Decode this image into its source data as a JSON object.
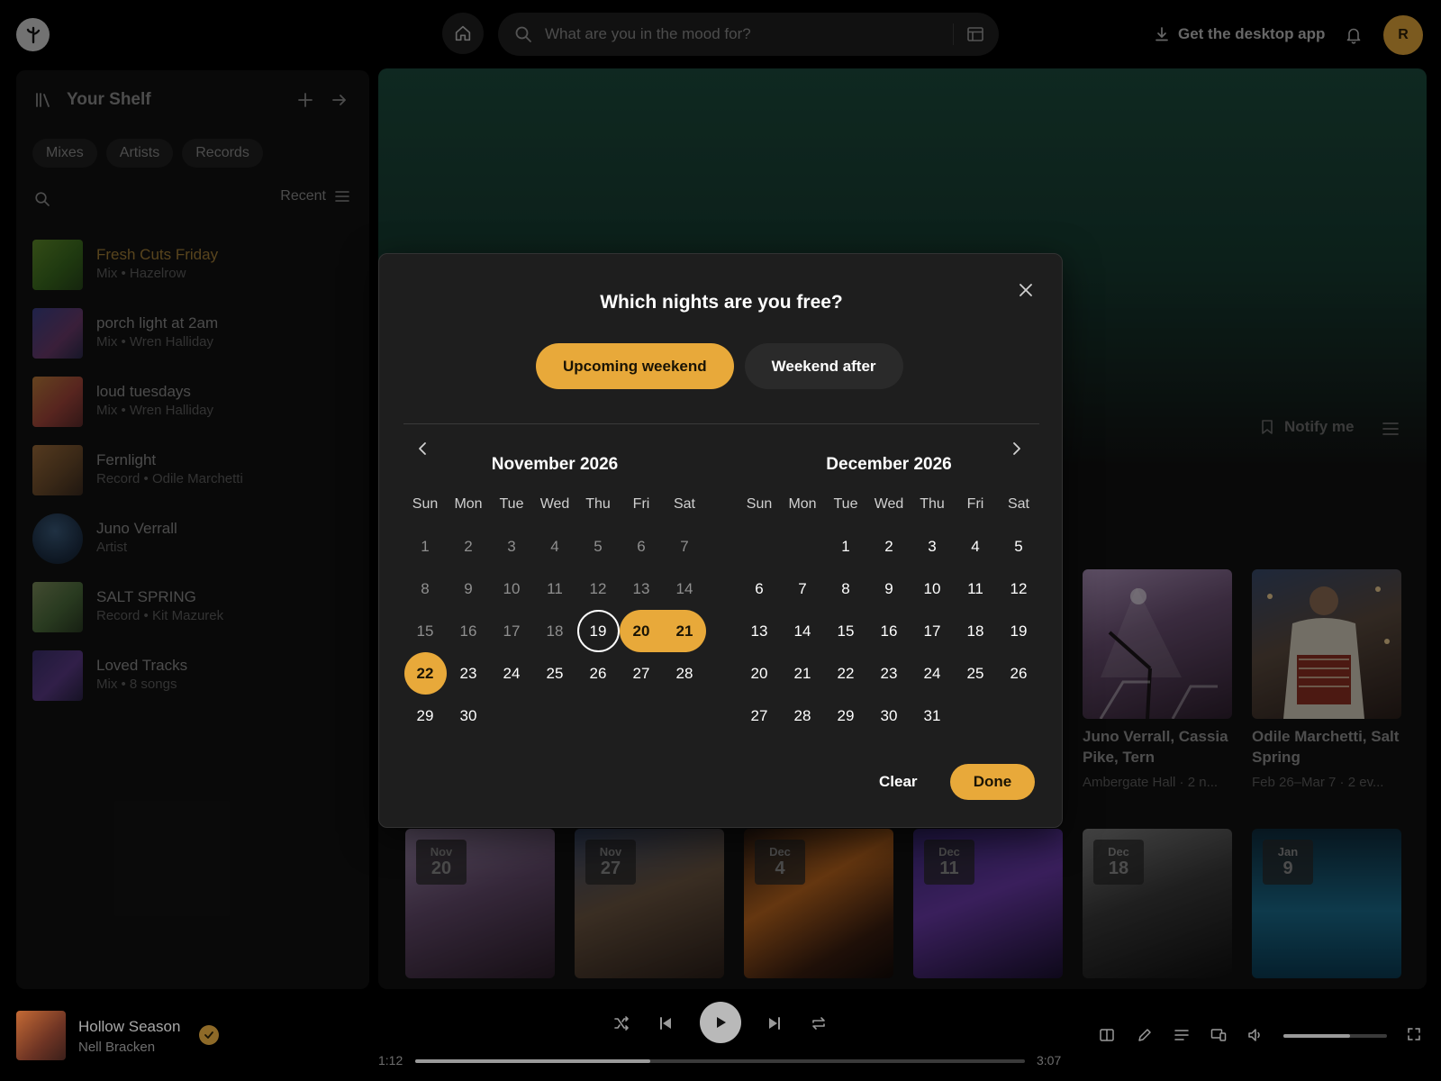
{
  "topbar": {
    "search_placeholder": "What are you in the mood for?",
    "get_app_label": "Get the desktop app",
    "avatar_initial": "R"
  },
  "sidebar": {
    "title": "Your Shelf",
    "filters": [
      "Mixes",
      "Artists",
      "Records"
    ],
    "sort_label": "Recent",
    "items": [
      {
        "title": "Fresh Cuts Friday",
        "subtitle": "Mix • Hazelrow",
        "active": true
      },
      {
        "title": "porch light at 2am",
        "subtitle": "Mix • Wren Halliday"
      },
      {
        "title": "loud tuesdays",
        "subtitle": "Mix • Wren Halliday"
      },
      {
        "title": "Fernlight",
        "subtitle": "Record • Odile Marchetti"
      },
      {
        "title": "Juno Verrall",
        "subtitle": "Artist"
      },
      {
        "title": "SALT SPRING",
        "subtitle": "Record • Kit Mazurek"
      },
      {
        "title": "Loved Tracks",
        "subtitle": "Mix • 8 songs"
      }
    ]
  },
  "main": {
    "notify_label": "Notify me",
    "cards": [
      {
        "title": "Juno Verrall, Cassia Pike, Tern",
        "subtitle": "Ambergate Hall · 2 n..."
      },
      {
        "title": "Odile Marchetti, Salt Spring",
        "subtitle": "Feb 26–Mar 7 · 2 ev..."
      }
    ],
    "event_tiles": [
      {
        "month": "Nov",
        "day": "20"
      },
      {
        "month": "Nov",
        "day": "27"
      },
      {
        "month": "Dec",
        "day": "4"
      },
      {
        "month": "Dec",
        "day": "11"
      },
      {
        "month": "Dec",
        "day": "18"
      },
      {
        "month": "Jan",
        "day": "9"
      }
    ]
  },
  "modal": {
    "title": "Which nights are you free?",
    "preset_upcoming": "Upcoming weekend",
    "preset_after": "Weekend after",
    "clear_label": "Clear",
    "done_label": "Done",
    "weekdays": [
      "Sun",
      "Mon",
      "Tue",
      "Wed",
      "Thu",
      "Fri",
      "Sat"
    ],
    "months": [
      {
        "title": "November 2026",
        "lead_blanks": 0,
        "days": 30,
        "past_until": 18,
        "today": 19,
        "selected": [
          20,
          21,
          22
        ]
      },
      {
        "title": "December 2026",
        "lead_blanks": 2,
        "days": 31,
        "past_until": 0,
        "today": null,
        "selected": []
      }
    ]
  },
  "player": {
    "title": "Hollow Season",
    "artist": "Nell Bracken",
    "elapsed": "1:12",
    "duration": "3:07",
    "progress_fraction": 0.385,
    "volume_fraction": 0.64
  },
  "colors": {
    "accent": "#e8a93a",
    "hero_green": "#1c4a3c",
    "background": "#000000",
    "panel": "#121212",
    "modal": "#1e1e1e"
  }
}
